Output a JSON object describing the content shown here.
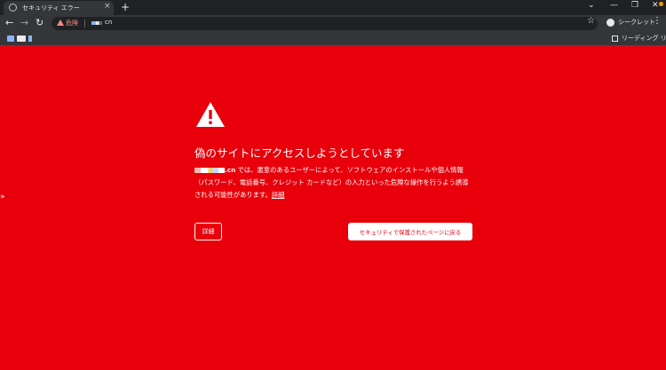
{
  "tab": {
    "title": "セキュリティ エラー",
    "close": "×",
    "icon": "globe-icon"
  },
  "newtab": "+",
  "window": {
    "dropdown": "⌄",
    "minimize": "—",
    "restore": "❐",
    "close": "✕"
  },
  "toolbar": {
    "back": "←",
    "forward": "→",
    "reload": "↻",
    "security_label": "危険",
    "url": "cn",
    "star": "☆",
    "profile_label": "シークレット",
    "menu": "⋮"
  },
  "bookmarks": {
    "reading_list": "リーディング リスト"
  },
  "interstitial": {
    "heading": "偽のサイトにアクセスしようとしています",
    "domain_suffix": ".cn",
    "body": " では、悪意のあるユーザーによって、ソフトウェアのインストールや個人情報（パスワード、電話番号、クレジット カードなど）の入力といった危険な操作を行うよう誘導される可能性があります。",
    "inline_details": "詳細",
    "details_button": "詳細",
    "back_button": "セキュリティで保護されたページに戻る"
  },
  "side_handle": "»",
  "colors": {
    "background": "#e8000b",
    "toolbar": "#35363a",
    "tabstrip": "#202124",
    "warning": "#f28b82"
  }
}
